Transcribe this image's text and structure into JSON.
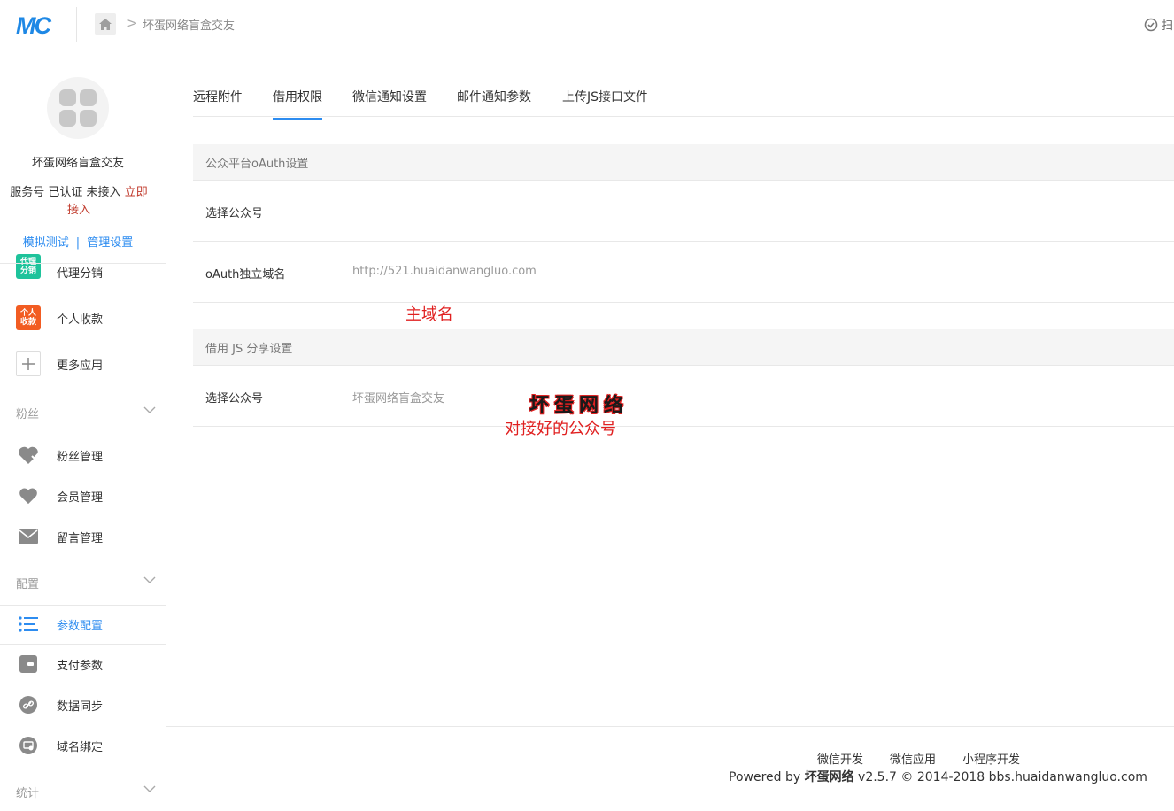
{
  "header": {
    "logo_text": "MC",
    "breadcrumb_arrow": ">",
    "breadcrumb_text": "坏蛋网络盲盒交友",
    "right_text": "扫"
  },
  "sidebar": {
    "account_name": "坏蛋网络盲盒交友",
    "status_prefix": "服务号 已认证 未接入 ",
    "status_link": "立即接入",
    "link_test": "模拟测试",
    "link_sep": "|",
    "link_manage": "管理设置",
    "apps": [
      {
        "label": "代理分销",
        "tile_top": "代理",
        "tile_bottom": "分销",
        "tile_color": "#1ec39b"
      },
      {
        "label": "个人收款",
        "tile_top": "个人",
        "tile_bottom": "收款",
        "tile_color": "#f25c22"
      },
      {
        "label": "更多应用"
      }
    ],
    "groups": {
      "fans": {
        "label": "粉丝",
        "items": [
          "粉丝管理",
          "会员管理",
          "留言管理"
        ]
      },
      "config": {
        "label": "配置",
        "items": [
          "参数配置",
          "支付参数",
          "数据同步",
          "域名绑定"
        ]
      },
      "stats": {
        "label": "统计"
      }
    }
  },
  "tabs": [
    "远程附件",
    "借用权限",
    "微信通知设置",
    "邮件通知参数",
    "上传JS接口文件"
  ],
  "active_tab": "借用权限",
  "sections": {
    "oauth": {
      "title": "公众平台oAuth设置",
      "rows": [
        {
          "label": "选择公众号",
          "value": ""
        },
        {
          "label": "oAuth独立域名",
          "value": "http://521.huaidanwangluo.com"
        }
      ]
    },
    "js": {
      "title": "借用 JS 分享设置",
      "rows": [
        {
          "label": "选择公众号",
          "value": "坏蛋网络盲盒交友"
        }
      ]
    }
  },
  "annotations": {
    "domain_note": "主域名",
    "account_note": "对接好的公众号",
    "watermark": "坏蛋网络"
  },
  "footer": {
    "links": [
      "微信开发",
      "微信应用",
      "小程序开发"
    ],
    "copy_prefix": "Powered by ",
    "copy_brand": "坏蛋网络",
    "copy_suffix": " v2.5.7 © 2014-2018 bbs.huaidanwangluo.com"
  },
  "colors": {
    "accent": "#2d8cf0",
    "annotation": "#e02020",
    "logo": "#1e88e5"
  }
}
